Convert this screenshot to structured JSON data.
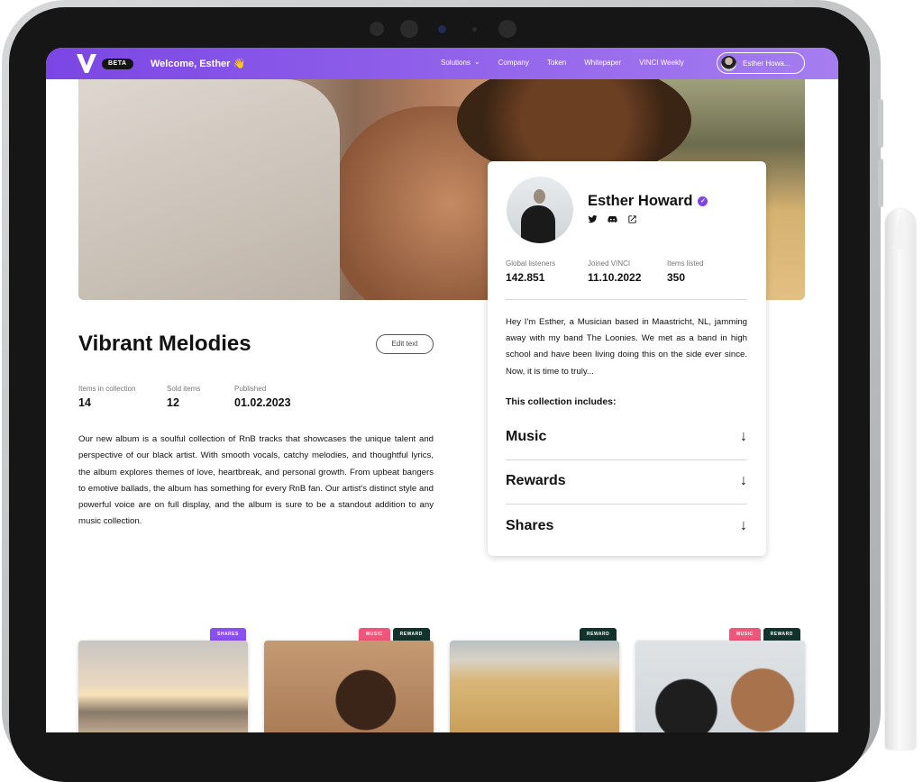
{
  "nav": {
    "beta": "BETA",
    "welcome": "Welcome, Esther 👋",
    "links": [
      "Solutions",
      "Company",
      "Token",
      "Whitepaper",
      "VINCI Weekly"
    ],
    "user_pill": "Esther Howa..."
  },
  "collection": {
    "title": "Vibrant Melodies",
    "edit_label": "Edit text",
    "stats": [
      {
        "label": "Items in collection",
        "value": "14"
      },
      {
        "label": "Sold items",
        "value": "12"
      },
      {
        "label": "Published",
        "value": "01.02.2023"
      }
    ],
    "description": "Our new album is a soulful collection of RnB tracks that showcases the unique talent and perspective of our black artist. With smooth vocals, catchy melodies, and thoughtful lyrics, the album explores themes of love, heartbreak, and personal growth. From upbeat bangers to emotive ballads, the album has something for every RnB fan. Our artist's distinct style and powerful voice are on full display, and the album is sure to be a standout addition to any music collection."
  },
  "profile": {
    "name": "Esther Howard",
    "stats": [
      {
        "label": "Global listeners",
        "value": "142.851"
      },
      {
        "label": "Joined VINCI",
        "value": "11.10.2022"
      },
      {
        "label": "Items listed",
        "value": "350"
      }
    ],
    "bio": "Hey I'm Esther, a Musician based in Maastricht, NL, jamming away with my band The Loonies. We met as a band in high school and have been living doing this on the side ever since. Now, it is time to truly...",
    "includes_heading": "This collection includes:",
    "sections": [
      "Music",
      "Rewards",
      "Shares"
    ]
  },
  "thumbnails": [
    {
      "tags": [
        "SHARES"
      ]
    },
    {
      "tags": [
        "MUSIC",
        "REWARD"
      ]
    },
    {
      "tags": [
        "REWARD"
      ]
    },
    {
      "tags": [
        "MUSIC",
        "REWARD"
      ]
    }
  ],
  "colors": {
    "accent": "#7b46e4",
    "music_tag": "#f0567a",
    "reward_tag": "#12332b",
    "shares_tag": "#8b4ff0"
  }
}
